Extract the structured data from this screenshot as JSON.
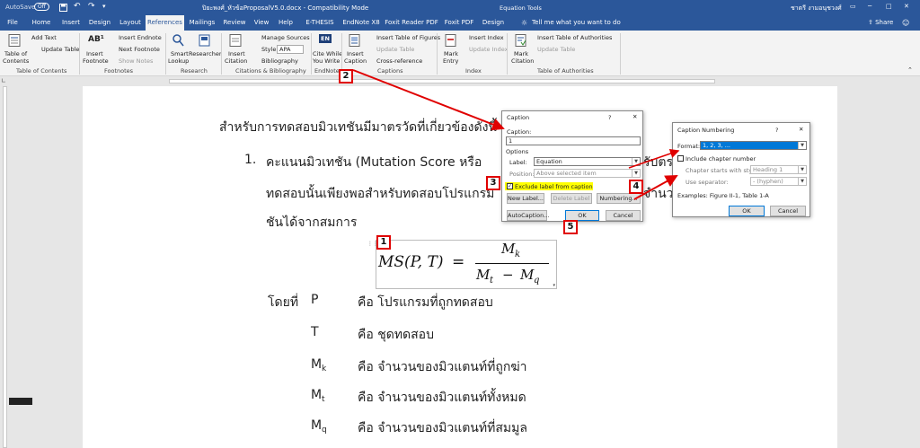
{
  "titlebar": {
    "autosave": "AutoSave",
    "autosave_state": "Off",
    "doc_title": "ปิยะพงศ์_หัวข้อProposalV5.0.docx - Compatibility Mode",
    "context": "Equation Tools",
    "user": "ชาตรี งามอนุชวงศ์"
  },
  "tabs": {
    "file": "File",
    "items": [
      "Home",
      "Insert",
      "Design",
      "Layout",
      "References",
      "Mailings",
      "Review",
      "View",
      "Help",
      "E-THESIS",
      "EndNote X8",
      "Foxit Reader PDF",
      "Foxit PDF",
      "Design"
    ],
    "tell_me": "Tell me what you want to do",
    "share": "Share"
  },
  "ribbon": {
    "toc": {
      "table_of": "Table of",
      "contents": "Contents",
      "add_text": "Add Text",
      "update_table": "Update Table",
      "group": "Table of Contents"
    },
    "footnotes": {
      "insert_footnote_1": "Insert",
      "insert_footnote_2": "Footnote",
      "ab_glyph": "AB¹",
      "insert_endnote": "Insert Endnote",
      "next_footnote": "Next Footnote",
      "show_notes": "Show Notes",
      "group": "Footnotes"
    },
    "research": {
      "smart_1": "Smart",
      "smart_2": "Lookup",
      "researcher": "Researcher",
      "group": "Research"
    },
    "citations": {
      "insert_1": "Insert",
      "insert_2": "Citation",
      "manage_sources": "Manage Sources",
      "style_label": "Style:",
      "style_value": "APA",
      "bibliography": "Bibliography",
      "group": "Citations & Bibliography"
    },
    "endnote": {
      "cite_1": "Cite While",
      "cite_2": "You Write",
      "en_glyph": "EN",
      "group": "EndNote"
    },
    "captions": {
      "insert_1": "Insert",
      "insert_2": "Caption",
      "insert_tof": "Insert Table of Figures",
      "update_table": "Update Table",
      "cross_reference": "Cross-reference",
      "group": "Captions"
    },
    "index": {
      "mark_1": "Mark",
      "mark_2": "Entry",
      "insert_index": "Insert Index",
      "update_index": "Update Index",
      "group": "Index"
    },
    "authorities": {
      "mark_1": "Mark",
      "mark_2": "Citation",
      "insert_toa": "Insert Table of Authorities",
      "update_table": "Update Table",
      "group": "Table of Authorities"
    }
  },
  "document": {
    "line1": "สำหรับการทดสอบมิวเทชันมีมาตรวัดที่เกี่ยวข้องดังนี้",
    "item_num": "1.",
    "item_text": "คะแนนมิวเทชัน (Mutation Score หรือ",
    "item_tail": "รับตร",
    "line3": "ทดสอบนั้นเพียงพอสำหรับทดสอบโปรแกรม",
    "line3_tail": "จำนวน",
    "line4": "ชันได้จากสมการ",
    "eq": {
      "ms": "MS(P, T)",
      "eqsign": "=",
      "num": "M",
      "num_sub": "k",
      "den_a": "M",
      "den_a_sub": "t",
      "minus": "−",
      "den_b": "M",
      "den_b_sub": "q"
    },
    "where": "โดยที่",
    "defs": [
      {
        "sym": "P",
        "sub": "",
        "text": "คือ โปรแกรมที่ถูกทดสอบ"
      },
      {
        "sym": "T",
        "sub": "",
        "text": "คือ ชุดทดสอบ"
      },
      {
        "sym": "M",
        "sub": "k",
        "text": "คือ จำนวนของมิวแตนท์ที่ถูกฆ่า"
      },
      {
        "sym": "M",
        "sub": "t",
        "text": "คือ จำนวนของมิวแตนท์ทั้งหมด"
      },
      {
        "sym": "M",
        "sub": "q",
        "text": "คือ จำนวนของมิวแตนท์ที่สมมูล"
      }
    ]
  },
  "caption_dialog": {
    "title": "Caption",
    "help": "?",
    "close": "✕",
    "caption_label": "Caption:",
    "caption_value": "1",
    "options": "Options",
    "label_label": "Label:",
    "label_value": "Equation",
    "position_label": "Position:",
    "position_value": "Above selected item",
    "exclude": "Exclude label from caption",
    "new_label": "New Label...",
    "delete_label": "Delete Label",
    "numbering": "Numbering...",
    "autocaption": "AutoCaption...",
    "ok": "OK",
    "cancel": "Cancel"
  },
  "numbering_dialog": {
    "title": "Caption Numbering",
    "help": "?",
    "close": "✕",
    "format_label": "Format:",
    "format_value": "1, 2, 3, ...",
    "include_chapter": "Include chapter number",
    "chapter_style_label": "Chapter starts with style",
    "chapter_style_value": "Heading 1",
    "separator_label": "Use separator:",
    "separator_value": "-    (hyphen)",
    "examples": "Examples:  Figure II-1, Table 1-A",
    "ok": "OK",
    "cancel": "Cancel"
  },
  "callouts": [
    "1",
    "2",
    "3",
    "4",
    "5"
  ],
  "colors": {
    "brand": "#2b579a",
    "annotation": "#e00000",
    "highlight": "#ffff00",
    "selection": "#0078d7"
  }
}
